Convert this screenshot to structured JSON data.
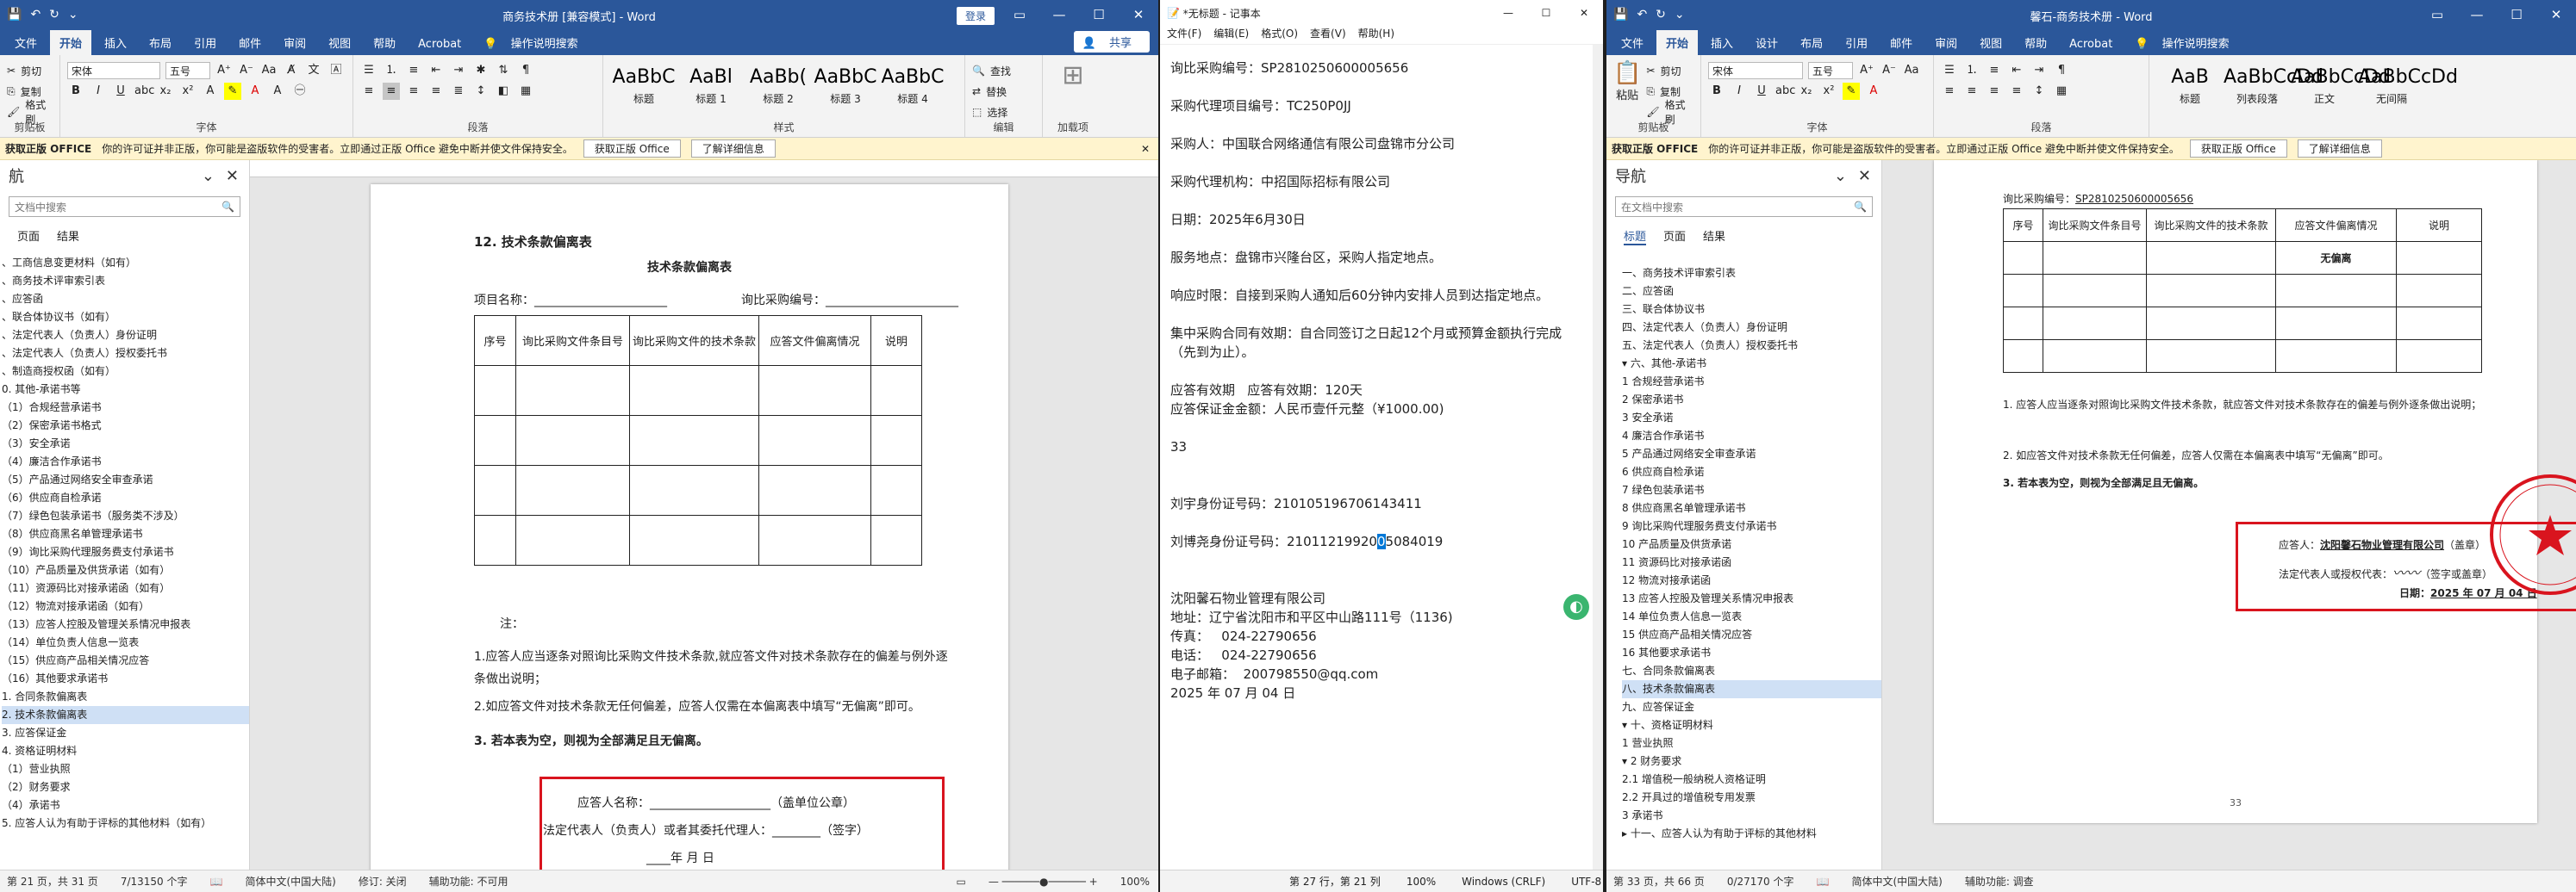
{
  "w1": {
    "title": "商务技术册 [兼容模式] - Word",
    "login": "登录",
    "share": "共享",
    "tabs": [
      "文件",
      "开始",
      "插入",
      "布局",
      "引用",
      "邮件",
      "审阅",
      "视图",
      "帮助",
      "Acrobat"
    ],
    "search": "操作说明搜索",
    "clip": [
      "剪切",
      "复制",
      "格式刷"
    ],
    "clip_label": "剪贴板",
    "font_name": "宋体",
    "font_size": "五号",
    "font_label": "字体",
    "para_label": "段落",
    "styles": [
      {
        "preview": "AaBbC",
        "name": "标题"
      },
      {
        "preview": "AaBl",
        "name": "标题 1"
      },
      {
        "preview": "AaBb(",
        "name": "标题 2"
      },
      {
        "preview": "AaBbC",
        "name": "标题 3"
      },
      {
        "preview": "AaBbC",
        "name": "标题 4"
      }
    ],
    "style_label": "样式",
    "edit": [
      "查找",
      "替换",
      "选择"
    ],
    "edit_label": "编辑",
    "addin_label": "加载项",
    "info_title": "获取正版 OFFICE",
    "info_text": "你的许可证并非正版，你可能是盗版软件的受害者。立即通过正版 Office 避免中断并使文件保持安全。",
    "info_btn1": "获取正版 Office",
    "info_btn2": "了解详细信息",
    "nav_title": "航",
    "nav_search": "文档中搜索",
    "nav_tabs": [
      "页面",
      "结果"
    ],
    "nav_items": [
      "、工商信息变更材料（如有）",
      "、商务技术评审索引表",
      "、应答函",
      "、联合体协议书（如有）",
      "、法定代表人（负责人）身份证明",
      "、法定代表人（负责人）授权委托书",
      "、制造商授权函（如有）",
      "0. 其他-承诺书等",
      "（1）合规经营承诺书",
      "（2）保密承诺书格式",
      "（3）安全承诺",
      "（4）廉洁合作承诺书",
      "（5）产品通过网络安全审查承诺",
      "（6）供应商自检承诺",
      "（7）绿色包装承诺书（服务类不涉及）",
      "（8）供应商黑名单管理承诺书",
      "（9）询比采购代理服务费支付承诺书",
      "（10）产品质量及供货承诺（如有）",
      "（11）资源码比对接承诺函（如有）",
      "（12）物流对接承诺函（如有）",
      "（13）应答人控股及管理关系情况申报表",
      "（14）单位负责人信息一览表",
      "（15）供应商产品相关情况应答",
      "（16）其他要求承诺书",
      "1. 合同条款偏离表",
      "2. 技术条款偏离表",
      "3. 应答保证金",
      "4. 资格证明材料",
      "（1）营业执照",
      "（2）财务要求",
      "（4）承诺书",
      "5. 应答人认为有助于评标的其他材料（如有）"
    ],
    "nav_selected": 25,
    "doc": {
      "heading": "12.   技术条款偏离表",
      "table_title": "技术条款偏离表",
      "project": "项目名称：",
      "code": "询比采购编号：",
      "cols": [
        "序号",
        "询比采购文件条目号",
        "询比采购文件的技术条款",
        "应答文件偏离情况",
        "说明"
      ],
      "note": "注：",
      "note1": "1.应答人应当逐条对照询比采购文件技术条款,就应答文件对技术条款存在的偏差与例外逐条做出说明；",
      "note2": "2.如应答文件对技术条款无任何偏差，应答人仅需在本偏离表中填写“无偏离”即可。",
      "note3": "3. 若本表为空，则视为全部满足且无偏离。",
      "sign1": "应答人名称：",
      "sign1b": "（盖单位公章）",
      "sign2": "法定代表人（负责人）或者其委托代理人：",
      "sign2b": "（签字）",
      "date": "年        月        日"
    },
    "status": [
      "第 21 页，共 31 页",
      "7/13150 个字",
      "简体中文(中国大陆)",
      "修订: 关闭",
      "辅助功能: 不可用"
    ],
    "zoom": "100%"
  },
  "w2": {
    "title": "*无标题 - 记事本",
    "menu": [
      "文件(F)",
      "编辑(E)",
      "格式(O)",
      "查看(V)",
      "帮助(H)"
    ],
    "lines": [
      "询比采购编号：SP2810250600005656",
      "",
      "采购代理项目编号：TC250P0JJ",
      "",
      "采购人：中国联合网络通信有限公司盘锦市分公司",
      "",
      "采购代理机构：中招国际招标有限公司",
      "",
      "日期：2025年6月30日",
      "",
      "服务地点：盘锦市兴隆台区，采购人指定地点。",
      "",
      "响应时限：自接到采购人通知后60分钟内安排人员到达指定地点。",
      "",
      "集中采购合同有效期：自合同签订之日起12个月或预算金额执行完成",
      "（先到为止）。",
      "",
      "应答有效期   应答有效期：120天",
      "应答保证金金额：人民币壹仟元整（¥1000.00)",
      "",
      "33",
      "",
      "",
      "刘宇身份证号码：210105196706143411",
      "",
      "刘博尧身份证号码：21011219920",
      "",
      "",
      "沈阳馨石物业管理有限公司",
      "地址：辽宁省沈阳市和平区中山路111号（1136)",
      "传真：   024-22790656",
      "电话：   024-22790656",
      "电子邮箱：  200798550@qq.com",
      "2025 年 07 月 04 日"
    ],
    "id_sel": "0",
    "id_rest": "5084019",
    "status": [
      "第 27 行，第 21 列",
      "100%",
      "Windows (CRLF)",
      "UTF-8"
    ]
  },
  "w3": {
    "title": "馨石-商务技术册 - Word",
    "tabs": [
      "文件",
      "开始",
      "插入",
      "设计",
      "布局",
      "引用",
      "邮件",
      "审阅",
      "视图",
      "帮助",
      "Acrobat"
    ],
    "search": "操作说明搜索",
    "paste": "粘贴",
    "clip": [
      "剪切",
      "复制",
      "格式刷"
    ],
    "clip_label": "剪贴板",
    "font_name": "宋体",
    "font_size": "五号",
    "font_label": "字体",
    "para_label": "段落",
    "styles": [
      {
        "preview": "AaB",
        "name": "标题"
      },
      {
        "preview": "AaBbCcDd",
        "name": "列表段落"
      },
      {
        "preview": "AaBbCcDd",
        "name": "正文"
      },
      {
        "preview": "AaBbCcDd",
        "name": "无间隔"
      }
    ],
    "info_title": "获取正版 OFFICE",
    "info_text": "你的许可证并非正版，你可能是盗版软件的受害者。立即通过正版 Office 避免中断并使文件保持安全。",
    "info_btn1": "获取正版 Office",
    "info_btn2": "了解详细信息",
    "nav_title": "导航",
    "nav_search": "在文档中搜索",
    "nav_tabs": [
      "标题",
      "页面",
      "结果"
    ],
    "nav_items": [
      "一、商务技术评审索引表",
      "二、应答函",
      "三、联合体协议书",
      "四、法定代表人（负责人）身份证明",
      "五、法定代表人（负责人）授权委托书",
      "▾ 六、其他-承诺书",
      "1 合规经营承诺书",
      "2 保密承诺书",
      "3 安全承诺",
      "4 廉洁合作承诺书",
      "5 产品通过网络安全审查承诺",
      "6 供应商自检承诺",
      "7 绿色包装承诺书",
      "8 供应商黑名单管理承诺书",
      "9 询比采购代理服务费支付承诺书",
      "10 产品质量及供货承诺",
      "11 资源码比对接承诺函",
      "12 物流对接承诺函",
      "13 应答人控股及管理关系情况申报表",
      "14 单位负责人信息一览表",
      "15 供应商产品相关情况应答",
      "16 其他要求承诺书",
      "七、合同条款偏离表",
      "八、技术条款偏离表",
      "九、应答保证金",
      "▾ 十、资格证明材料",
      "1 营业执照",
      "▾ 2 财务要求",
      "2.1 增值税一般纳税人资格证明",
      "2.2 开具过的增值税专用发票",
      "3 承诺书",
      "▸ 十一、应答人认为有助于评标的其他材料"
    ],
    "nav_selected": 23,
    "doc": {
      "code": "询比采购编号：",
      "code_val": "SP2810250600005656",
      "cols": [
        "序号",
        "询比采购文件条目号",
        "询比采购文件的技术条款",
        "应答文件偏离情况",
        "说明"
      ],
      "cell": "无偏离",
      "note1": "1. 应答人应当逐条对照询比采购文件技术条款，就应答文件对技术条款存在的偏差与例外逐条做出说明；",
      "note2": "2. 如应答文件对技术条款无任何偏差，应答人仅需在本偏离表中填写“无偏离”即可。",
      "note3": "3. 若本表为空，则视为全部满足且无偏离。",
      "sign1": "应答人：",
      "company": "沈阳馨石物业管理有限公司",
      "stamp_hint": "（盖章）",
      "sign2": "法定代表人或授权代表：",
      "sign2b": "（签字或盖章）",
      "date_label": "日期：",
      "date": "2025 年 07 月 04 日",
      "page_num": "33"
    },
    "status": [
      "第 33 页，共 66 页",
      "0/27170 个字",
      "简体中文(中国大陆)",
      "辅助功能: 调查"
    ],
    "colors": {
      "word_blue": "#2b579a",
      "stamp_red": "#d9141e"
    }
  }
}
